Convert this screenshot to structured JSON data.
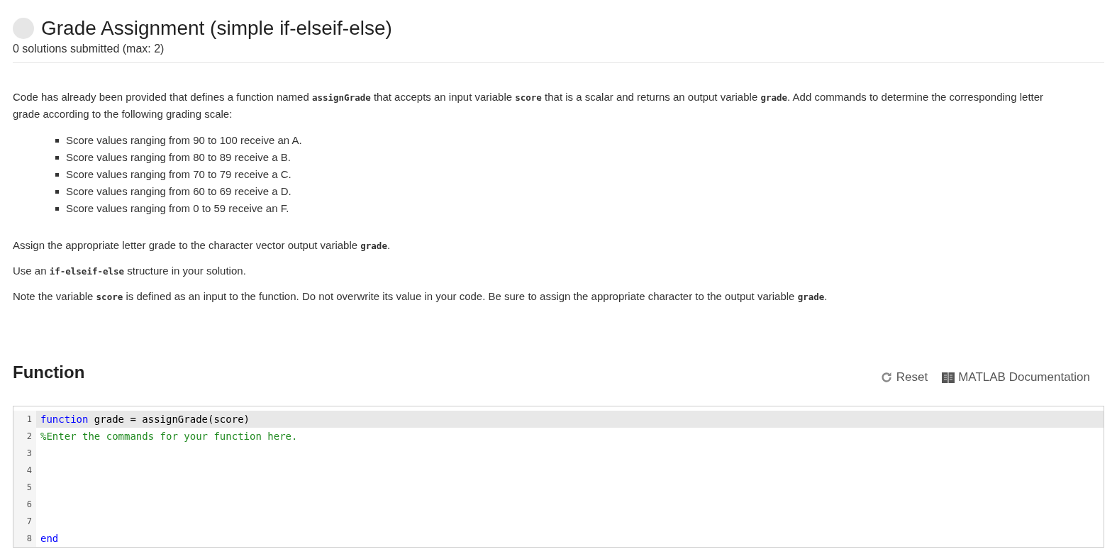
{
  "header": {
    "title": "Grade Assignment (simple if-elseif-else)",
    "subtitle": "0 solutions submitted (max: 2)"
  },
  "description": {
    "intro": "Code has already been provided that defines a function named **assignGrade** that accepts an input variable **score** that is a scalar and returns an output variable **grade**.  Add commands to determine the corresponding letter grade according to the following grading scale:",
    "bullets": [
      "Score values ranging from 90 to 100 receive an A.",
      "Score values ranging from 80 to 89 receive a B.",
      "Score values ranging from 70 to 79 receive a C.",
      "Score values ranging from 60 to 69 receive a D.",
      "Score values ranging from 0 to 59 receive an F."
    ],
    "paragraphs": [
      "Assign the appropriate letter grade to the character vector output variable **grade**.",
      "Use an **if-elseif-else** structure in your solution.",
      "Note the variable **score** is defined as an input to the function.  Do not overwrite its value in your code.  Be sure to assign the appropriate character to the output variable **grade**."
    ]
  },
  "function_section": {
    "heading": "Function",
    "actions": [
      {
        "kind": "reset",
        "label": "Reset"
      },
      {
        "kind": "docs",
        "label": "MATLAB Documentation"
      }
    ]
  },
  "editor": {
    "lines": [
      {
        "number": "1",
        "selected": true,
        "tokens": [
          {
            "kind": "keyword",
            "text": "function"
          },
          {
            "kind": "plain",
            "text": " grade = assignGrade(score)"
          }
        ]
      },
      {
        "number": "2",
        "selected": false,
        "tokens": [
          {
            "kind": "comment",
            "text": "%Enter the commands for your function here."
          }
        ]
      },
      {
        "number": "3",
        "selected": false
      },
      {
        "number": "4",
        "selected": false
      },
      {
        "number": "5",
        "selected": false
      },
      {
        "number": "6",
        "selected": false
      },
      {
        "number": "7",
        "selected": false
      },
      {
        "number": "8",
        "selected": false,
        "tokens": [
          {
            "kind": "keyword",
            "text": "end"
          }
        ]
      }
    ]
  }
}
